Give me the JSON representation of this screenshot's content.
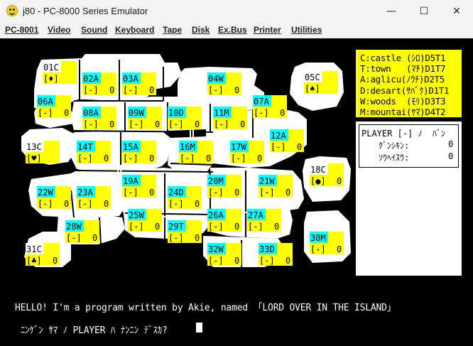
{
  "window": {
    "title": "j80 - PC-8000 Series Emulator",
    "minimize_glyph": "—",
    "maximize_glyph": "☐",
    "close_glyph": "✕",
    "icon": "smiley-icon"
  },
  "menu": [
    "PC-8001",
    "Video",
    "Sound",
    "Keyboard",
    "Tape",
    "Disk",
    "Ex.Bus",
    "Printer",
    "Utilities"
  ],
  "colors": {
    "screen_bg": "#000000",
    "land": "#ffffff",
    "label_blue": "#00ffff",
    "label_white": "#ffffff",
    "field_yellow": "#ffff00",
    "text_white": "#ffffff"
  },
  "map": {
    "territories": [
      {
        "code": "01C",
        "blue": false,
        "marker": "[♦]",
        "value": ""
      },
      {
        "code": "02A",
        "blue": true,
        "marker": "[-]",
        "value": "0"
      },
      {
        "code": "03A",
        "blue": true,
        "marker": "[-]",
        "value": "0"
      },
      {
        "code": "04W",
        "blue": true,
        "marker": "[-]",
        "value": "0"
      },
      {
        "code": "05C",
        "blue": false,
        "marker": "[♠]",
        "value": ""
      },
      {
        "code": "06A",
        "blue": true,
        "marker": "[-]",
        "value": "0"
      },
      {
        "code": "07A",
        "blue": true,
        "marker": "[-]",
        "value": "0"
      },
      {
        "code": "08A",
        "blue": true,
        "marker": "[-]",
        "value": "0"
      },
      {
        "code": "09W",
        "blue": true,
        "marker": "[-]",
        "value": "0"
      },
      {
        "code": "10D",
        "blue": true,
        "marker": "[-]",
        "value": "0"
      },
      {
        "code": "11M",
        "blue": true,
        "marker": "[-]",
        "value": "0"
      },
      {
        "code": "12A",
        "blue": true,
        "marker": "[-]",
        "value": "0"
      },
      {
        "code": "13C",
        "blue": false,
        "marker": "[♥]",
        "value": ""
      },
      {
        "code": "14T",
        "blue": true,
        "marker": "[-]",
        "value": "0"
      },
      {
        "code": "15A",
        "blue": true,
        "marker": "[-]",
        "value": "0"
      },
      {
        "code": "16M",
        "blue": true,
        "marker": "[-]",
        "value": "0"
      },
      {
        "code": "17W",
        "blue": true,
        "marker": "[-]",
        "value": "0"
      },
      {
        "code": "18C",
        "blue": false,
        "marker": "[●]",
        "value": "0"
      },
      {
        "code": "19A",
        "blue": true,
        "marker": "[-]",
        "value": "0"
      },
      {
        "code": "20M",
        "blue": true,
        "marker": "[-]",
        "value": "0"
      },
      {
        "code": "21W",
        "blue": true,
        "marker": "[-]",
        "value": "0"
      },
      {
        "code": "22W",
        "blue": true,
        "marker": "[-]",
        "value": "0"
      },
      {
        "code": "23A",
        "blue": true,
        "marker": "[-]",
        "value": "0"
      },
      {
        "code": "24D",
        "blue": true,
        "marker": "[-]",
        "value": "0"
      },
      {
        "code": "25W",
        "blue": true,
        "marker": "[-]",
        "value": "0"
      },
      {
        "code": "26A",
        "blue": true,
        "marker": "[-]",
        "value": "0"
      },
      {
        "code": "27A",
        "blue": true,
        "marker": "[-]",
        "value": "0"
      },
      {
        "code": "28W",
        "blue": true,
        "marker": "[-]",
        "value": "0"
      },
      {
        "code": "29T",
        "blue": true,
        "marker": "[-]",
        "value": "0"
      },
      {
        "code": "30M",
        "blue": true,
        "marker": "[-]",
        "value": "0"
      },
      {
        "code": "31C",
        "blue": false,
        "marker": "[♣]",
        "value": "0"
      },
      {
        "code": "32W",
        "blue": true,
        "marker": "[-]",
        "value": "0"
      },
      {
        "code": "33D",
        "blue": true,
        "marker": "[-]",
        "value": "0"
      }
    ]
  },
  "legend": [
    "C:castle (ｼﾛ)D5T1",
    "T:town   (ﾏﾁ)D1T7",
    "A:aglicu(ﾉｳﾁ)D2T5",
    "D:desart(ｻﾊﾞｸ)D1T1",
    "W:woods  (ﾓﾘ)D3T3",
    "M:mountai(ﾔﾏ)D4T2"
  ],
  "player_panel": {
    "header": "PLAYER [-] ﾉ  ﾊﾞﾝ",
    "row1_label": "ｸﾞﾝｼｷﾝ:",
    "row1_value": "0",
    "row2_label": "ｿｳﾍｲｽｳ:",
    "row2_value": "0"
  },
  "messages": {
    "line1": "HELLO! I'm a program written by Akie, named 「LORD OVER IN THE ISLAND」",
    "line2": "ﾆﾝｹﾞﾝ ｻﾏ ﾉ PLAYER ﾊ ﾅﾝﾆﾝ ﾃﾞｽｶ?"
  }
}
